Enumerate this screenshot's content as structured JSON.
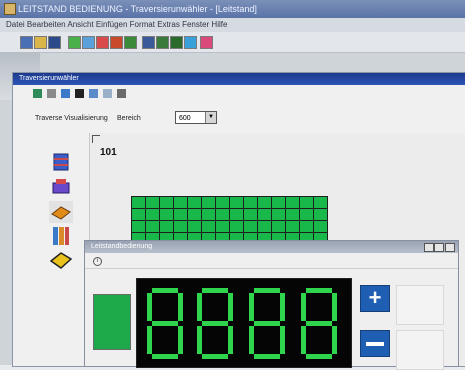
{
  "app": {
    "title": "LEITSTAND BEDIENUNG - Traversierunwähler - [Leitstand]"
  },
  "menubar": {
    "items_text": "Datei   Bearbeiten   Ansicht   Einfügen   Format   Extras   Fenster   Hilfe"
  },
  "window": {
    "title": "Traversierunwähler"
  },
  "controls": {
    "visualization_label": "Traverse Visualisierung",
    "bereich_label": "Bereich",
    "bereich_value": "600"
  },
  "grid": {
    "aisle_number": "101",
    "rows": 11,
    "cols": 14,
    "brown_region": {
      "rows": [
        6,
        10
      ],
      "cols": [
        0,
        3
      ]
    },
    "occupied_color": "#19b84a",
    "alt_color": "#a87b55"
  },
  "subwindow": {
    "title": "Leitstandbedienung"
  },
  "display": {
    "digits": "8888",
    "segment_color": "#2fd64d",
    "plus_label": "+",
    "minus_label": "",
    "status_color": "#1eaa4b"
  },
  "icons": {
    "toolbar": [
      "new-icon",
      "open-icon",
      "save-icon",
      "cut-icon",
      "copy-icon",
      "paste-icon",
      "print-icon",
      "undo-icon",
      "redo-icon",
      "find-icon",
      "zoom-icon",
      "help-icon",
      "stop-icon"
    ],
    "window_toolbar": [
      "grid-icon",
      "layers-icon",
      "refresh-icon",
      "binoculars-icon",
      "filter-icon",
      "list-icon",
      "settings-icon"
    ],
    "side": [
      "rack-icon",
      "pallet-icon",
      "box-icon",
      "shelf-icon",
      "package-icon"
    ]
  }
}
